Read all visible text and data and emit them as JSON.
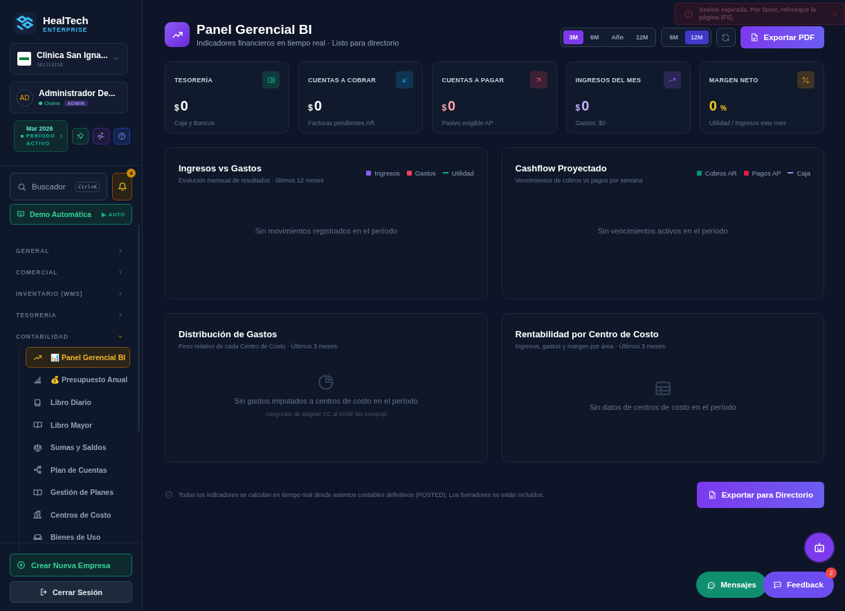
{
  "sidebar": {
    "brand": {
      "name": "HealTech",
      "edition": "ENTERPRISE"
    },
    "company": {
      "name": "Clinica San Igna...",
      "id": "381314158"
    },
    "user": {
      "initials": "AD",
      "name": "Administrador De...",
      "status": "Online",
      "role": "ADMIN"
    },
    "period": {
      "month": "Mar 2026",
      "label": "PERÍODO ACTIVO"
    },
    "search": {
      "placeholder": "Buscador",
      "shortcut": "Ctrl+K"
    },
    "notifications": {
      "count": "4"
    },
    "demo": {
      "label": "Demo Automática",
      "mode": "▶ AUTO"
    },
    "nav": [
      {
        "label": "GENERAL",
        "expanded": false
      },
      {
        "label": "COMERCIAL",
        "expanded": false
      },
      {
        "label": "INVENTARIO (WMS)",
        "expanded": false
      },
      {
        "label": "TESORERÍA",
        "expanded": false
      },
      {
        "label": "CONTABILIDAD",
        "expanded": true,
        "children": [
          {
            "label": "📊 Panel Gerencial BI",
            "selected": true
          },
          {
            "label": "💰 Presupuesto Anual",
            "selected": false
          },
          {
            "label": "Libro Diario",
            "selected": false
          },
          {
            "label": "Libro Mayor",
            "selected": false
          },
          {
            "label": "Sumas y Saldos",
            "selected": false
          },
          {
            "label": "Plan de Cuentas",
            "selected": false
          },
          {
            "label": "Gestión de Planes",
            "selected": false
          },
          {
            "label": "Centros de Costo",
            "selected": false
          },
          {
            "label": "Bienes de Uso",
            "selected": false
          }
        ]
      }
    ],
    "create_button": "Crear Nueva Empresa",
    "logout_button": "Cerrar Sesión"
  },
  "header": {
    "title": "Panel Gerencial BI",
    "subtitle": "Indicadores financieros en tiempo real · Listo para directorio",
    "ranges": [
      {
        "label": "3M",
        "selected": true
      },
      {
        "label": "6M",
        "selected": false
      },
      {
        "label": "Año",
        "selected": false
      },
      {
        "label": "12M",
        "selected": false
      }
    ],
    "compare": [
      {
        "label": "6M",
        "selected": false
      },
      {
        "label": "12M",
        "selected": true
      }
    ],
    "export_button": "Exportar PDF"
  },
  "toast": {
    "message": "Sesión expirada. Por favor, refresque la página (F5)."
  },
  "kpis": [
    {
      "label": "TESORERÍA",
      "prefix": "$",
      "value": "0",
      "note": "Caja y Bancos",
      "color": "#10b981"
    },
    {
      "label": "CUENTAS A COBRAR",
      "prefix": "$",
      "value": "0",
      "note": "Facturas pendientes AR",
      "color": "#0ea5e9"
    },
    {
      "label": "CUENTAS A PAGAR",
      "prefix": "$",
      "value": "0",
      "note": "Pasivo exigible AP",
      "color": "#f43f5e"
    },
    {
      "label": "INGRESOS DEL MES",
      "prefix": "$",
      "value": "0",
      "note": "Gastos: $0",
      "color": "#8b5cf6"
    },
    {
      "label": "MARGEN NETO",
      "value": "0",
      "suffix": "%",
      "note": "Utilidad / Ingresos este mes",
      "color": "#f59e0b"
    }
  ],
  "charts": [
    {
      "title": "Ingresos vs Gastos",
      "subtitle": "Evolución mensual de resultados · últimos 12 meses",
      "legend": [
        {
          "label": "Ingresos",
          "kind": "square",
          "color": "#8b5cf6"
        },
        {
          "label": "Gastos",
          "kind": "square",
          "color": "#f43f5e"
        },
        {
          "label": "Utilidad",
          "kind": "line",
          "color": "#10b981"
        }
      ],
      "empty": "Sin movimientos registrados en el período"
    },
    {
      "title": "Cashflow Proyectado",
      "subtitle": "Vencimientos de cobros vs pagos por semana",
      "legend": [
        {
          "label": "Cobros AR",
          "kind": "square",
          "color": "#059669"
        },
        {
          "label": "Pagos AP",
          "kind": "square",
          "color": "#e11d48"
        },
        {
          "label": "Caja",
          "kind": "line",
          "color": "#a78bfa"
        }
      ],
      "empty": "Sin vencimientos activos en el período"
    },
    {
      "title": "Distribución de Gastos",
      "subtitle": "Peso relativo de cada Centro de Costo · Últimos 3 meses",
      "empty": "Sin gastos imputados a centros de costo en el período",
      "hint": "Asegurate de asignar CC al emitir las compras"
    },
    {
      "title": "Rentabilidad por Centro de Costo",
      "subtitle": "Ingresos, gastos y margen por área · Últimos 3 meses",
      "empty": "Sin datos de centros de costo en el período"
    }
  ],
  "footer": {
    "note": "Todos los indicadores se calculan en tiempo real desde asientos contables definitivos (POSTED). Los borradores no están incluidos.",
    "export_button": "Exportar para Directorio"
  },
  "floating": {
    "messages_button": "Mensajes",
    "feedback_button": "Feedback",
    "feedback_count": "2"
  }
}
